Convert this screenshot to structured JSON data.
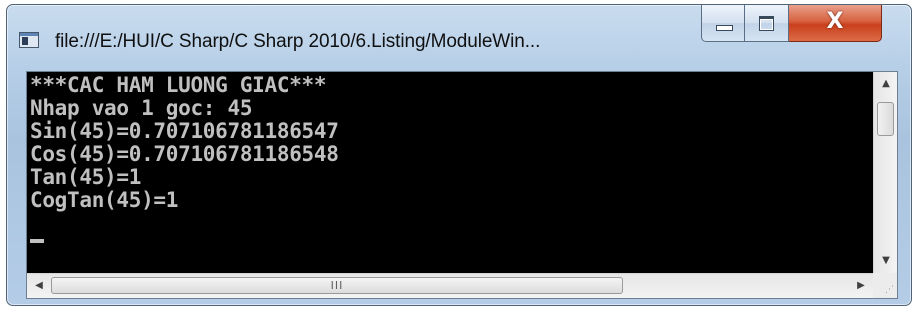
{
  "window": {
    "title": "file:///E:/HUI/C Sharp/C Sharp 2010/6.Listing/ModuleWin...",
    "icon": "console-window-icon",
    "buttons": {
      "minimize": "minimize-icon",
      "maximize": "maximize-icon",
      "close_glyph": "X"
    }
  },
  "console": {
    "lines": [
      "***CAC HAM LUONG GIAC***",
      "Nhap vao 1 goc: 45",
      "Sin(45)=0.707106781186547",
      "Cos(45)=0.707106781186548",
      "Tan(45)=1",
      "CogTan(45)=1"
    ],
    "cursor": "_",
    "text_color": "#c0c0c0",
    "background": "#000000"
  },
  "scrollbars": {
    "vertical": {
      "up_arrow": "▲",
      "down_arrow": "▼"
    },
    "horizontal": {
      "left_arrow": "◀",
      "right_arrow": "▶",
      "thumb_grip": "III"
    }
  },
  "colors": {
    "close_button": "#c9401d",
    "title_bar": "#b7cfe7"
  }
}
